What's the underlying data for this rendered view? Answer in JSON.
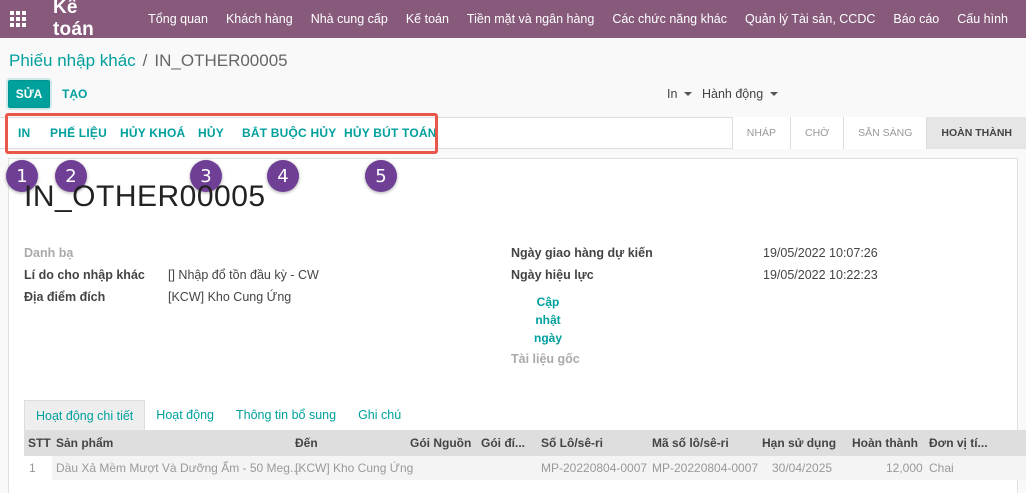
{
  "navbar": {
    "brand": "Kế toán",
    "menu": [
      "Tổng quan",
      "Khách hàng",
      "Nhà cung cấp",
      "Kế toán",
      "Tiền mặt và ngân hàng",
      "Các chức năng khác",
      "Quản lý Tài sản, CCDC",
      "Báo cáo",
      "Cấu hình"
    ]
  },
  "breadcrumb": {
    "parent": "Phiếu nhập khác",
    "separator": "/",
    "current": "IN_OTHER00005"
  },
  "buttons": {
    "edit": "SỬA",
    "create": "TẠO",
    "print": "In",
    "action": "Hành động"
  },
  "actions": [
    "IN",
    "PHẾ LIỆU",
    "HỦY KHOÁ",
    "HỦY",
    "BẮT BUỘC HỦY",
    "HỦY BÚT TOÁN"
  ],
  "stages": [
    "NHÁP",
    "CHỜ",
    "SẴN SÀNG",
    "HOÀN THÀNH"
  ],
  "active_stage": "HOÀN THÀNH",
  "badges": [
    "1",
    "2",
    "3",
    "4",
    "5"
  ],
  "record": {
    "title": "IN_OTHER00005",
    "contact_label": "Danh bạ",
    "reason_label": "Lí do cho nhập khác",
    "reason_value": "[] Nhập đổ tồn đầu kỳ - CW",
    "dest_label": "Địa điểm đích",
    "dest_value": "[KCW] Kho Cung Ứng",
    "scheduled_label": "Ngày giao hàng dự kiến",
    "scheduled_value": "19/05/2022 10:07:26",
    "effective_label": "Ngày hiệu lực",
    "effective_value": "19/05/2022 10:22:23",
    "update_link": [
      "Cập",
      "nhật",
      "ngày"
    ],
    "source_doc_label": "Tài liệu gốc"
  },
  "tabs": [
    "Hoạt động chi tiết",
    "Hoạt động",
    "Thông tin bổ sung",
    "Ghi chú"
  ],
  "table": {
    "headers": [
      "STT",
      "Sản phẩm",
      "Đến",
      "Gói Nguồn",
      "Gói đí...",
      "Số Lô/sê-ri",
      "Mã số lô/sê-ri",
      "Hạn sử dụng",
      "Hoàn thành",
      "Đơn vị tí..."
    ],
    "rows": [
      [
        "1",
        "Dầu Xả Mềm Mượt Và Dưỡng Ẩm - 50 Meg...",
        "[KCW] Kho Cung Ứng",
        "",
        "",
        "MP-20220804-0007",
        "MP-20220804-0007",
        "30/04/2025",
        "12,000",
        "Chai"
      ]
    ]
  },
  "colors": {
    "navbar": "#875a7b",
    "accent": "#00a09d",
    "highlight": "#e8574a",
    "badge": "#6f3f96"
  }
}
